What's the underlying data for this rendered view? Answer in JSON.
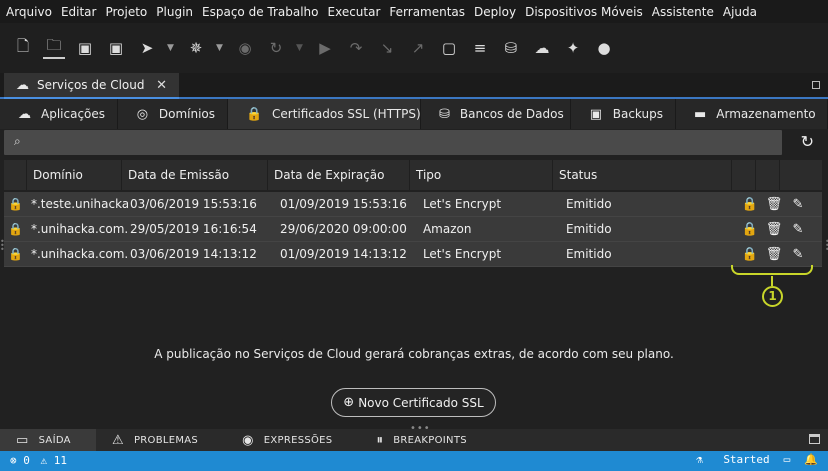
{
  "menu": [
    "Arquivo",
    "Editar",
    "Projeto",
    "Plugin",
    "Espaço de Trabalho",
    "Executar",
    "Ferramentas",
    "Deploy",
    "Dispositivos Móveis",
    "Assistente",
    "Ajuda"
  ],
  "toolbar_icons": [
    "new-file-icon",
    "open-folder-icon",
    "save-icon",
    "save-all-icon",
    "rocket-icon",
    "bug-icon",
    "stop-icon",
    "publish-icon",
    "run-icon",
    "redo-icon",
    "download-icon",
    "upload-icon",
    "terminal-icon",
    "database-search-icon",
    "database-icon",
    "cloud-icon",
    "wand-icon",
    "chat-icon"
  ],
  "editor_tab": {
    "label": "Serviços de Cloud",
    "close": "✕"
  },
  "subtabs": [
    {
      "label": "Aplicações",
      "icon": "cloud-upload-icon"
    },
    {
      "label": "Domínios",
      "icon": "globe-icon"
    },
    {
      "label": "Certificados SSL (HTTPS)",
      "icon": "lock-icon"
    },
    {
      "label": "Bancos de Dados",
      "icon": "database-icon"
    },
    {
      "label": "Backups",
      "icon": "backup-icon"
    },
    {
      "label": "Armazenamento",
      "icon": "folder-icon"
    }
  ],
  "table": {
    "columns": [
      "Domínio",
      "Data de Emissão",
      "Data de Expiração",
      "Tipo",
      "Status"
    ],
    "rows": [
      {
        "domain": "*.teste.unihacka.",
        "issued": "03/06/2019 15:53:16",
        "expires": "01/09/2019 15:53:16",
        "type": "Let's Encrypt",
        "status": "Emitido"
      },
      {
        "domain": "*.unihacka.com.b",
        "issued": "29/05/2019 16:16:54",
        "expires": "29/06/2020 09:00:00",
        "type": "Amazon",
        "status": "Emitido"
      },
      {
        "domain": "*.unihacka.com.b",
        "issued": "03/06/2019 14:13:12",
        "expires": "01/09/2019 14:13:12",
        "type": "Let's Encrypt",
        "status": "Emitido"
      }
    ]
  },
  "annotation_number": "1",
  "notice": "A publicação no Serviços de Cloud gerará cobranças extras, de acordo com seu plano.",
  "new_cert_button": "Novo Certificado SSL",
  "bottom_tabs": [
    {
      "label": "SAÍDA",
      "icon": "output-icon"
    },
    {
      "label": "PROBLEMAS",
      "icon": "warning-icon"
    },
    {
      "label": "EXPRESSÕES",
      "icon": "eye-icon"
    },
    {
      "label": "BREAKPOINTS",
      "icon": "pause-icon"
    }
  ],
  "status": {
    "errors": "0",
    "warnings": "11",
    "state": "Started"
  },
  "colors": {
    "accent": "#1f8ad2",
    "lock_green": "#3cba54",
    "annotation": "#c8d62a"
  }
}
